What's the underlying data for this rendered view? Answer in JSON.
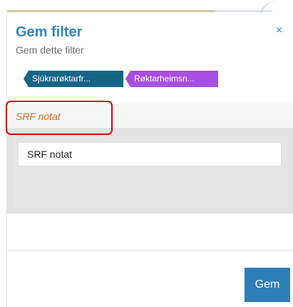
{
  "dialog": {
    "title": "Gem filter",
    "subtitle": "Gem dette filter",
    "close_icon": "×"
  },
  "tags": [
    {
      "label": "Sjúkrarøktarfr...",
      "color": "#176585"
    },
    {
      "label": "Røktarheimsn...",
      "color": "#a64fe0"
    }
  ],
  "section": {
    "label": "SRF notat",
    "input_value": "SRF notat"
  },
  "footer": {
    "save_label": "Gem"
  },
  "colors": {
    "accent": "#2f86c7",
    "button": "#2e7eb8",
    "label": "#e06b1d",
    "highlight": "#d9000f"
  }
}
